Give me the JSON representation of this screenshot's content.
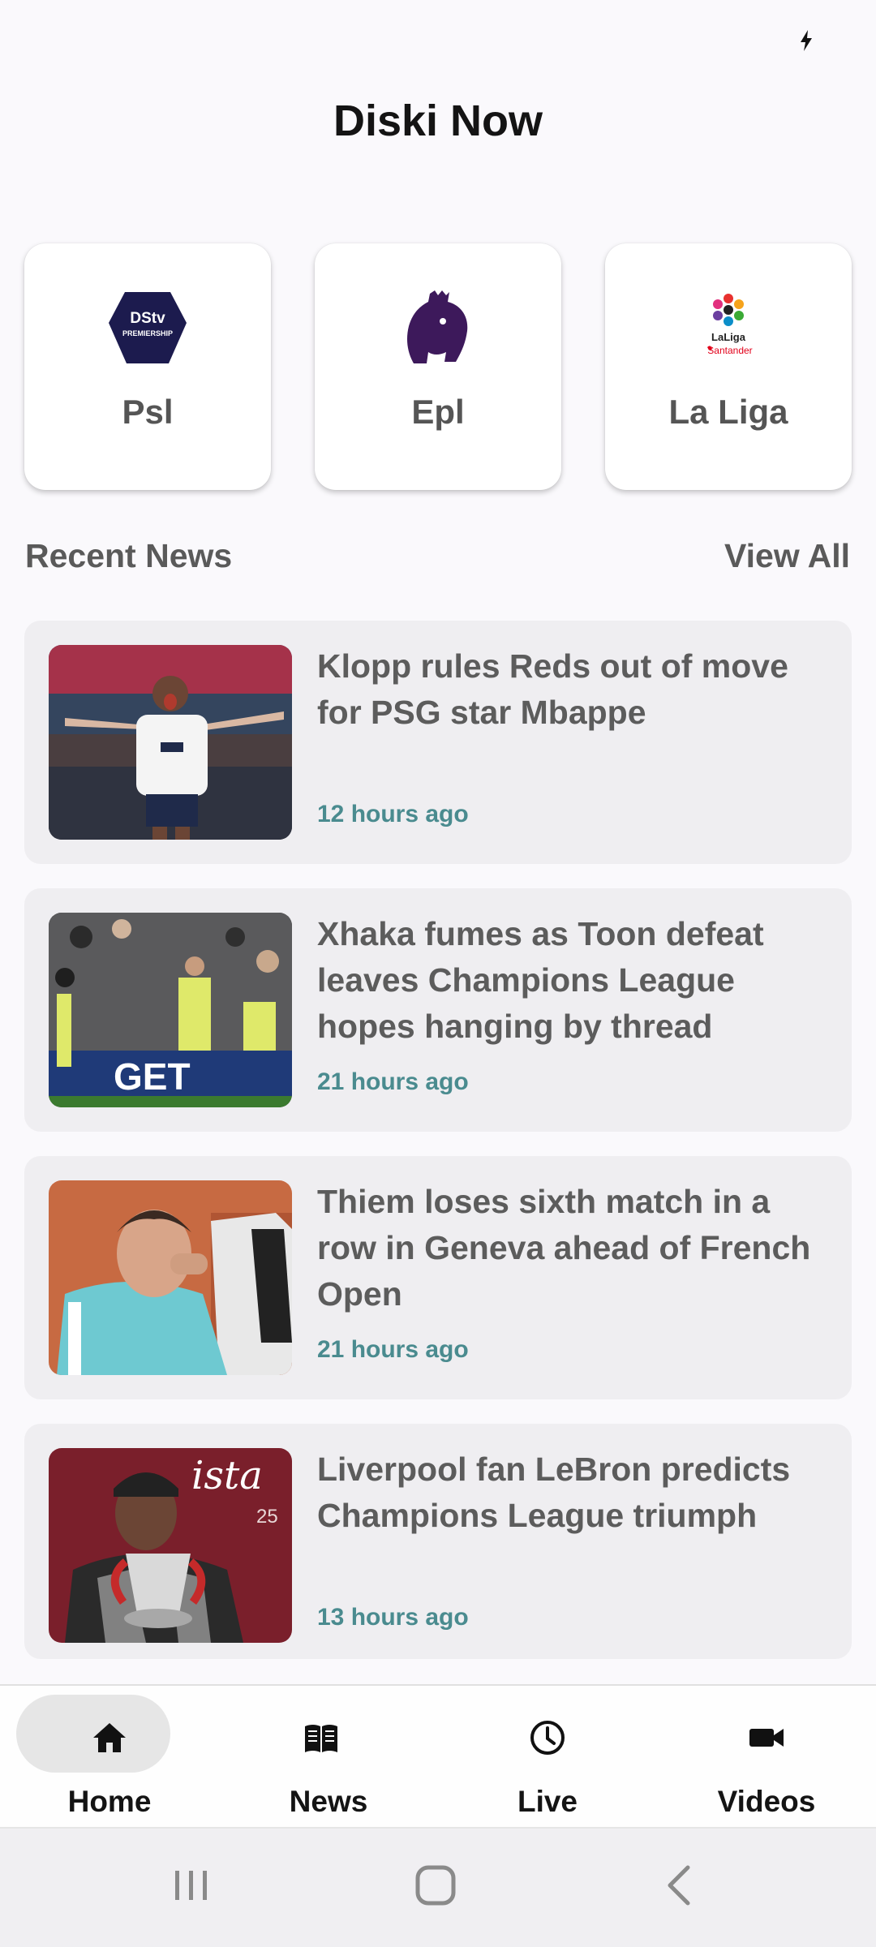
{
  "app": {
    "title": "Diski Now"
  },
  "status_bar": {
    "icon": "flash-icon"
  },
  "leagues": [
    {
      "label": "Psl",
      "logo_text": "DStv PREMIERSHIP",
      "color": "#1c1b4e"
    },
    {
      "label": "Epl",
      "color": "#3d195b"
    },
    {
      "label": "La Liga",
      "logo_text_1": "LaLiga",
      "logo_text_2": "Santander"
    }
  ],
  "recent_news": {
    "title": "Recent News",
    "view_all_label": "View All",
    "items": [
      {
        "headline": "Klopp rules Reds out of move for PSG star Mbappe",
        "time": "12 hours ago"
      },
      {
        "headline": "Xhaka fumes as Toon defeat leaves Champions League hopes hanging by thread",
        "time": "21 hours ago",
        "thumb_text": "GET"
      },
      {
        "headline": "Thiem loses sixth match in a row in Geneva ahead of French Open",
        "time": "21 hours ago"
      },
      {
        "headline": "Liverpool fan LeBron predicts Champions League triumph",
        "time": "13 hours ago",
        "thumb_text": "ista",
        "thumb_number": "25"
      }
    ]
  },
  "bottom_nav": [
    {
      "label": "Home",
      "icon": "home-icon",
      "active": true
    },
    {
      "label": "News",
      "icon": "news-icon",
      "active": false
    },
    {
      "label": "Live",
      "icon": "clock-icon",
      "active": false
    },
    {
      "label": "Videos",
      "icon": "video-camera-icon",
      "active": false
    }
  ],
  "system_nav": {
    "recents": "recents-icon",
    "home": "home-button-icon",
    "back": "back-icon"
  },
  "colors": {
    "accent_time": "#4a8b8f",
    "card_bg": "#efeef1",
    "nav_active_pill": "#e6e6e6"
  }
}
